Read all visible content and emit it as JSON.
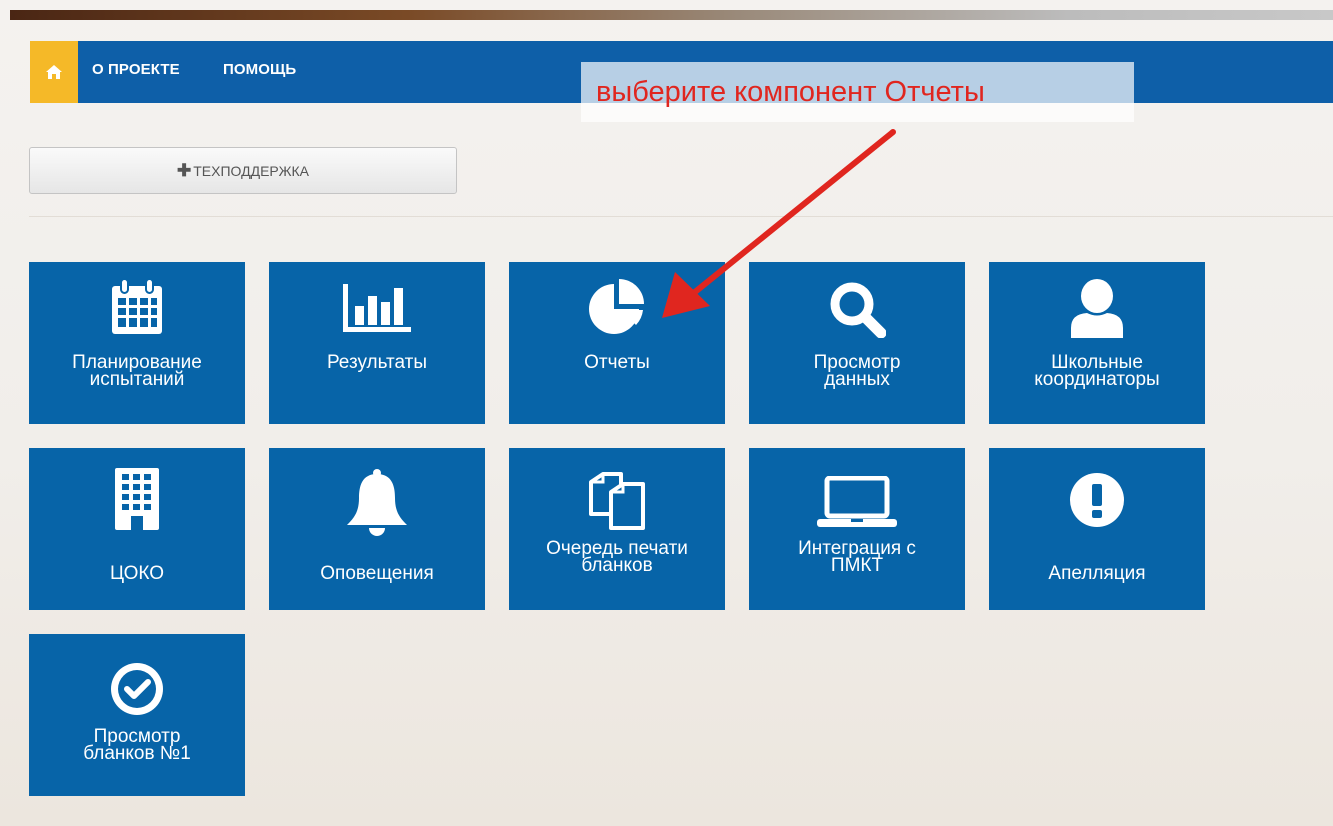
{
  "nav": {
    "home_icon": "home-icon",
    "links": [
      "О ПРОЕКТЕ",
      "ПОМОЩЬ"
    ]
  },
  "callout": {
    "text": "выберите компонент Отчеты",
    "color": "#e0261f"
  },
  "support": {
    "label": "ТЕХПОДДЕРЖКА",
    "icon": "plus-icon"
  },
  "colors": {
    "tile": "#0764a8",
    "navbar": "#0e5fa8",
    "home": "#f5b928"
  },
  "tiles": [
    {
      "label": "Планирование\nиспытаний",
      "icon": "calendar-icon"
    },
    {
      "label": "Результаты",
      "icon": "bar-chart-icon"
    },
    {
      "label": "Отчеты",
      "icon": "pie-chart-icon"
    },
    {
      "label": "Просмотр\nданных",
      "icon": "search-icon"
    },
    {
      "label": "Школьные\nкоординаторы",
      "icon": "user-icon"
    },
    {
      "label": "ЦОКО",
      "icon": "building-icon"
    },
    {
      "label": "Оповещения",
      "icon": "bell-icon"
    },
    {
      "label": "Очередь печати\nбланков",
      "icon": "copy-icon"
    },
    {
      "label": "Интеграция с\nПМКТ",
      "icon": "laptop-icon"
    },
    {
      "label": "Апелляция",
      "icon": "exclamation-icon"
    },
    {
      "label": "Просмотр\nбланков №1",
      "icon": "check-circle-icon"
    }
  ]
}
